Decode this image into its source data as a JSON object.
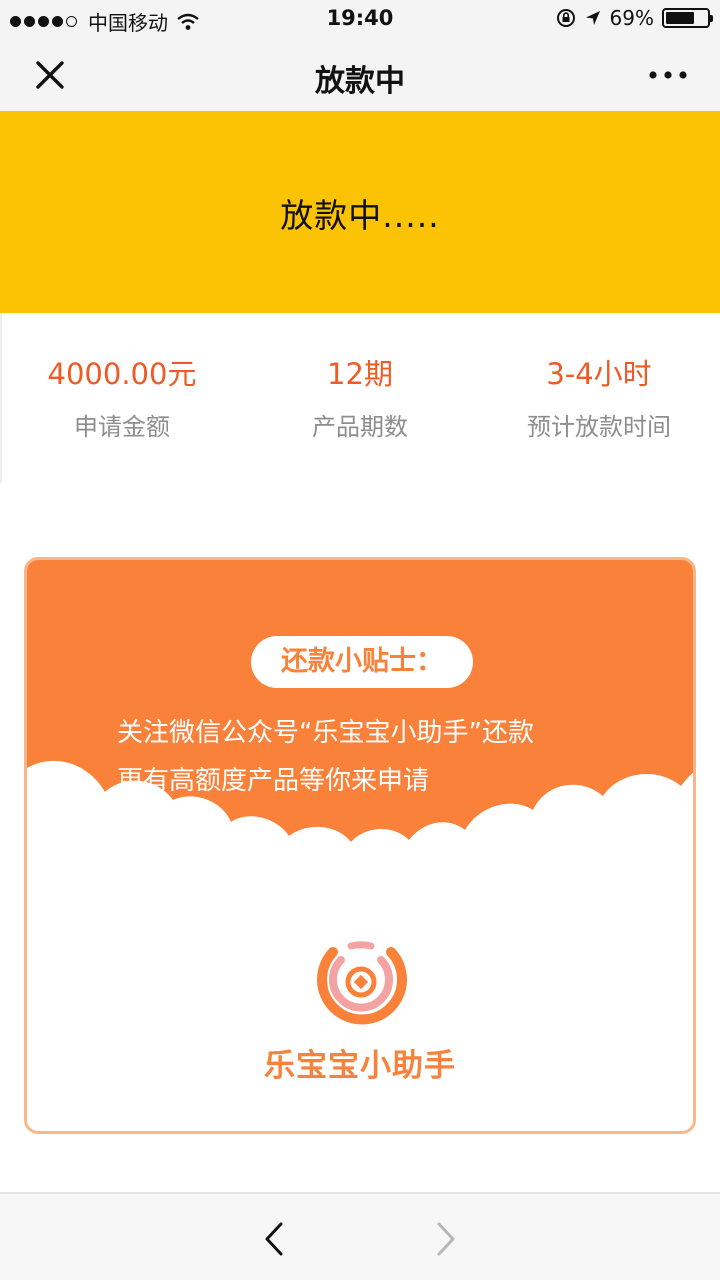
{
  "status_bar": {
    "carrier": "中国移动",
    "time": "19:40",
    "battery": "69%",
    "battery_level": 0.69,
    "icons": [
      "signal-icon",
      "wifi-icon",
      "orientation-lock-icon",
      "location-arrow-icon",
      "battery-icon"
    ]
  },
  "nav": {
    "title": "放款中",
    "close_icon": "close-icon",
    "more_icon": "more-icon"
  },
  "banner": {
    "text": "放款中....."
  },
  "summary": {
    "amount": {
      "value": "4000.00元",
      "label": "申请金额"
    },
    "term": {
      "value": "12期",
      "label": "产品期数"
    },
    "time": {
      "value": "3-4小时",
      "label": "预计放款时间"
    }
  },
  "tips": {
    "badge": "还款小贴士：",
    "line1": "关注微信公众号“乐宝宝小助手”还款",
    "line2": "更有高额度产品等你来申请",
    "brand_name": "乐宝宝小助手"
  },
  "toolbar": {
    "back_icon": "back-arrow-icon",
    "forward_icon": "forward-arrow-icon"
  },
  "colors": {
    "banner": "#fbc304",
    "accent_orange": "#f9813a",
    "stat_value": "#f05a24",
    "label_gray": "#8e8e8e"
  }
}
